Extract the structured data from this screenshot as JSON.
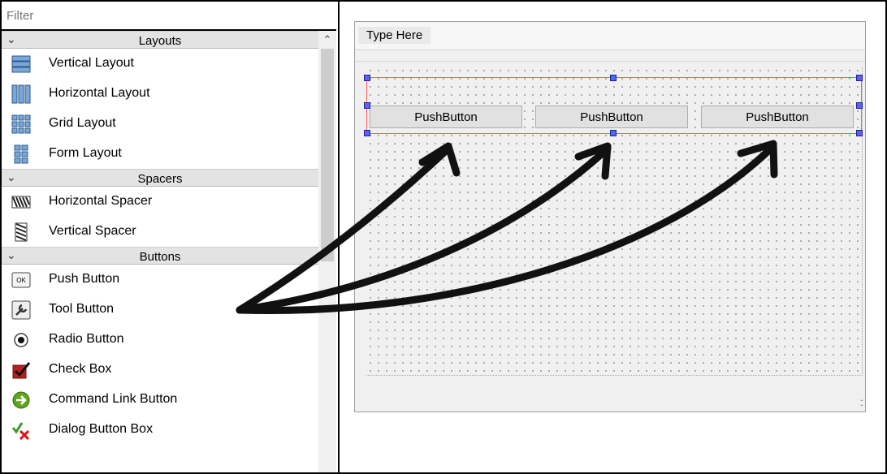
{
  "widget_box": {
    "filter_placeholder": "Filter",
    "categories": [
      {
        "label": "Layouts",
        "items": [
          {
            "label": "Vertical Layout",
            "icon": "vertical-layout-icon"
          },
          {
            "label": "Horizontal Layout",
            "icon": "horizontal-layout-icon"
          },
          {
            "label": "Grid Layout",
            "icon": "grid-layout-icon"
          },
          {
            "label": "Form Layout",
            "icon": "form-layout-icon"
          }
        ]
      },
      {
        "label": "Spacers",
        "items": [
          {
            "label": "Horizontal Spacer",
            "icon": "horizontal-spacer-icon"
          },
          {
            "label": "Vertical Spacer",
            "icon": "vertical-spacer-icon"
          }
        ]
      },
      {
        "label": "Buttons",
        "items": [
          {
            "label": "Push Button",
            "icon": "push-button-icon",
            "icon_text": "OK"
          },
          {
            "label": "Tool Button",
            "icon": "tool-button-icon"
          },
          {
            "label": "Radio Button",
            "icon": "radio-button-icon"
          },
          {
            "label": "Check Box",
            "icon": "check-box-icon"
          },
          {
            "label": "Command Link Button",
            "icon": "command-link-icon"
          },
          {
            "label": "Dialog Button Box",
            "icon": "dialog-button-box-icon"
          }
        ]
      }
    ]
  },
  "form": {
    "menu_placeholder": "Type Here",
    "buttons": [
      "PushButton",
      "PushButton",
      "PushButton"
    ]
  },
  "colors": {
    "layout_border": "#ff6060",
    "handle": "#5f5ff0",
    "arrow": "#111111"
  }
}
